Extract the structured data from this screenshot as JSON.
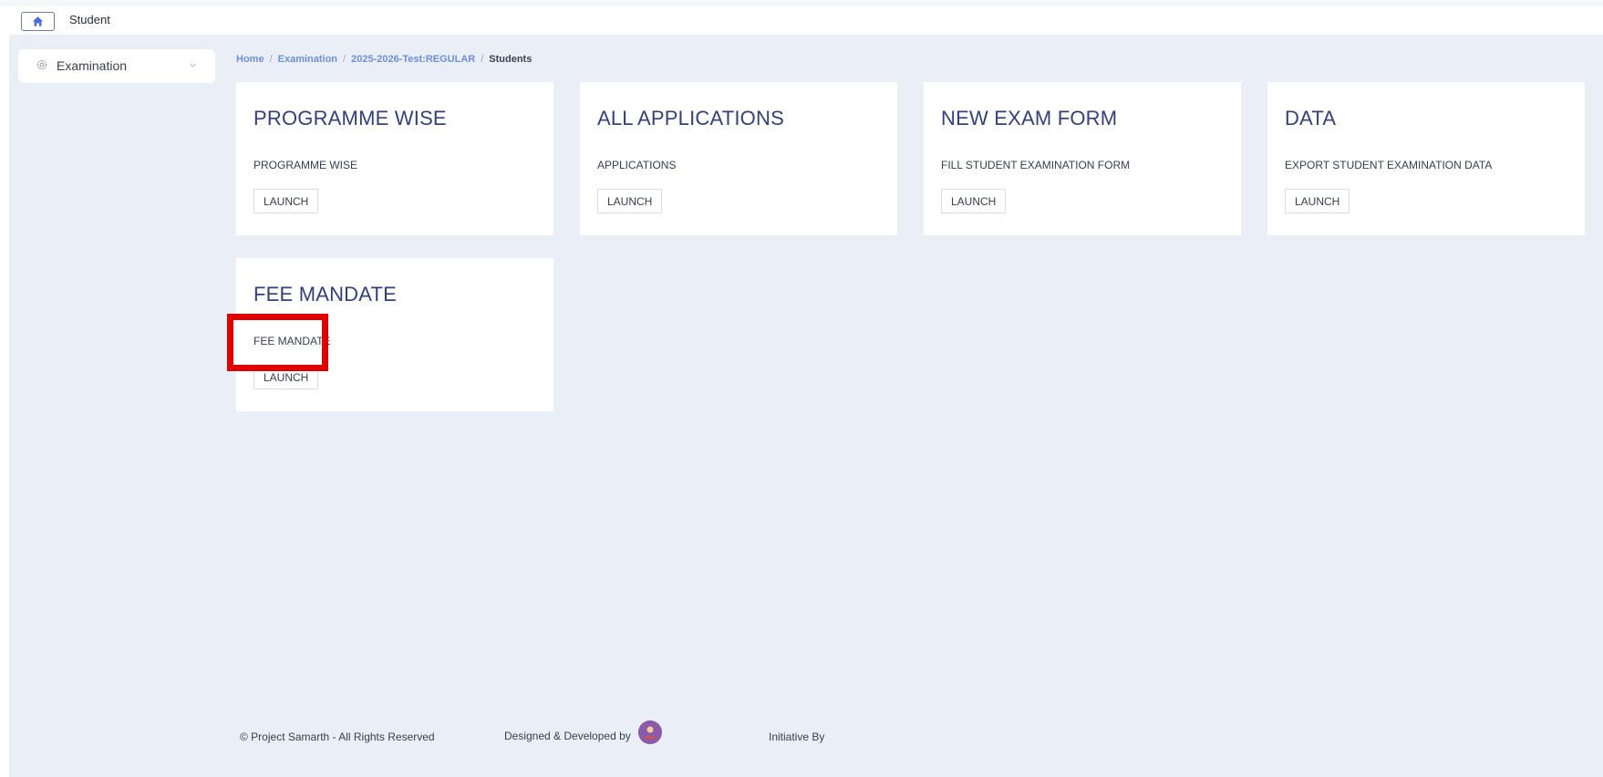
{
  "topbar": {
    "title": "Student",
    "home_icon": "home-icon"
  },
  "sidebar": {
    "items": [
      {
        "label": "Examination",
        "icon": "gear-icon"
      }
    ]
  },
  "breadcrumb": {
    "items": [
      "Home",
      "Examination",
      "2025-2026-Test:REGULAR"
    ],
    "separator": "/",
    "current": "Students"
  },
  "cards": [
    {
      "title": "PROGRAMME WISE",
      "desc": "PROGRAMME WISE",
      "button": "LAUNCH"
    },
    {
      "title": "ALL APPLICATIONS",
      "desc": "APPLICATIONS",
      "button": "LAUNCH"
    },
    {
      "title": "NEW EXAM FORM",
      "desc": "FILL STUDENT EXAMINATION FORM",
      "button": "LAUNCH"
    },
    {
      "title": "DATA",
      "desc": "EXPORT STUDENT EXAMINATION DATA",
      "button": "LAUNCH"
    },
    {
      "title": "FEE MANDATE",
      "desc": "FEE MANDATE",
      "button": "LAUNCH"
    }
  ],
  "footer": {
    "copyright": "© Project Samarth - All Rights Reserved",
    "designed_by": "Designed & Developed by",
    "initiative_by": "Initiative By"
  },
  "colors": {
    "background": "#eaeef6",
    "card_title": "#34407a",
    "breadcrumb_link": "#6e8fd6",
    "highlight": "#e00000"
  }
}
